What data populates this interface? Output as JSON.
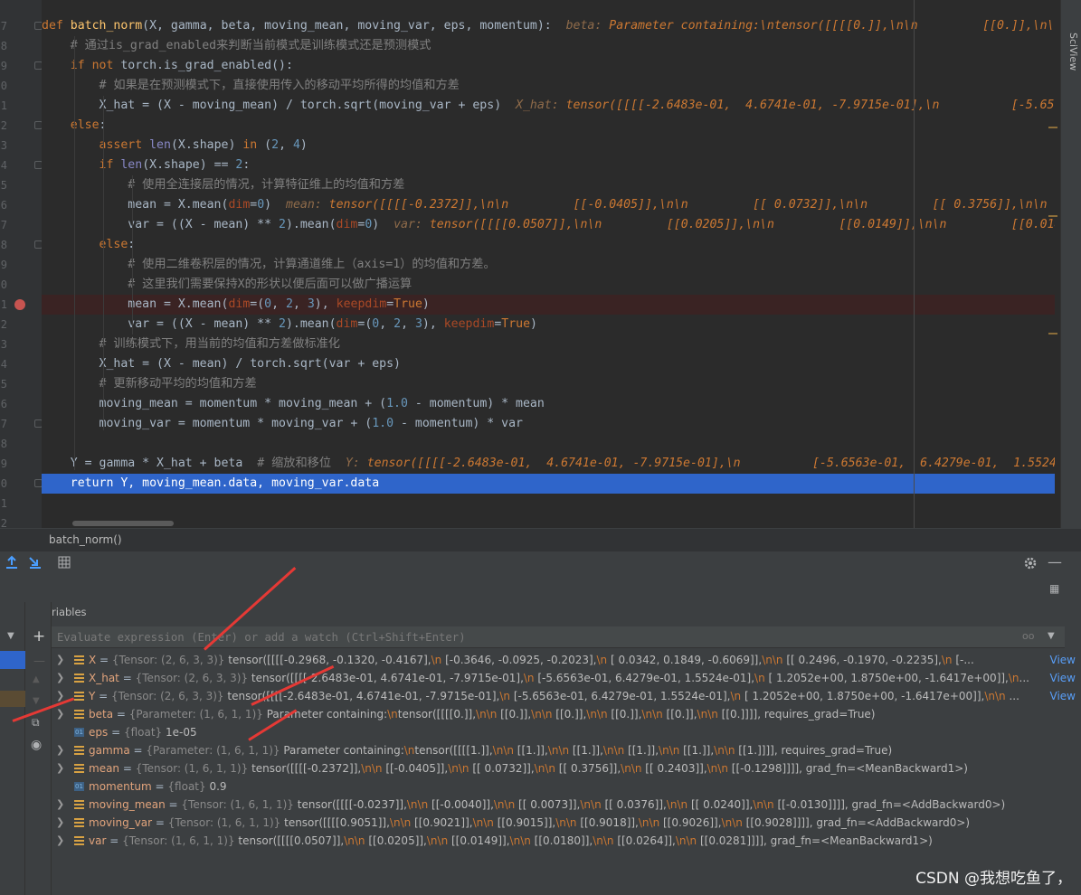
{
  "editor": {
    "line_numbers": [
      "7",
      "8",
      "9",
      "0",
      "1",
      "2",
      "3",
      "4",
      "5",
      "6",
      "7",
      "8",
      "9",
      "0",
      "1",
      "2",
      "3",
      "4",
      "5",
      "6",
      "7",
      "8",
      "9",
      "0",
      "1",
      "2",
      "3"
    ],
    "lines": [
      [
        [
          "kw",
          "def "
        ],
        [
          "fn",
          "batch_norm"
        ],
        [
          "",
          "(X, gamma, beta, moving_mean, moving_var, eps, momentum):"
        ],
        [
          "inlv",
          "  beta: "
        ],
        [
          "inl",
          "Parameter containing:\\ntensor([[[[0.]],\\n\\n         [[0.]],\\n\\n"
        ]
      ],
      [
        [
          "",
          "    "
        ],
        [
          "cm",
          "# 通过is_grad_enabled来判断当前模式是训练模式还是预测模式"
        ]
      ],
      [
        [
          "",
          "    "
        ],
        [
          "kw",
          "if not "
        ],
        [
          "",
          "torch.is_grad_enabled():"
        ]
      ],
      [
        [
          "",
          "        "
        ],
        [
          "cm",
          "# 如果是在预测模式下，直接使用传入的移动平均所得的均值和方差"
        ]
      ],
      [
        [
          "",
          "        X_hat = (X - moving_mean) / torch.sqrt(moving_var + eps)"
        ],
        [
          "inlv",
          "  X_hat: "
        ],
        [
          "inl",
          "tensor([[[[-2.6483e-01,  4.6741e-01, -7.9715e-01],\\n          [-5.6563e-01"
        ]
      ],
      [
        [
          "",
          "    "
        ],
        [
          "kw",
          "else"
        ],
        [
          "",
          ":"
        ]
      ],
      [
        [
          "",
          "        "
        ],
        [
          "kw",
          "assert "
        ],
        [
          "bi",
          "len"
        ],
        [
          "",
          "(X.shape) "
        ],
        [
          "kw",
          "in "
        ],
        [
          "",
          "("
        ],
        [
          "num",
          "2"
        ],
        [
          "",
          ", "
        ],
        [
          "num",
          "4"
        ],
        [
          "",
          ")"
        ]
      ],
      [
        [
          "",
          "        "
        ],
        [
          "kw",
          "if "
        ],
        [
          "bi",
          "len"
        ],
        [
          "",
          "(X.shape) == "
        ],
        [
          "num",
          "2"
        ],
        [
          "",
          ":"
        ]
      ],
      [
        [
          "",
          "            "
        ],
        [
          "cm",
          "# 使用全连接层的情况，计算特征维上的均值和方差"
        ]
      ],
      [
        [
          "",
          "            mean = X.mean("
        ],
        [
          "named",
          "dim"
        ],
        [
          "",
          "="
        ],
        [
          "num",
          "0"
        ],
        [
          "",
          ")"
        ],
        [
          "inlv",
          "  mean: "
        ],
        [
          "inl",
          "tensor([[[[-0.2372]],\\n\\n         [[-0.0405]],\\n\\n         [[ 0.0732]],\\n\\n         [[ 0.3756]],\\n\\n"
        ]
      ],
      [
        [
          "",
          "            var = ((X - mean) ** "
        ],
        [
          "num",
          "2"
        ],
        [
          "",
          ").mean("
        ],
        [
          "named",
          "dim"
        ],
        [
          "",
          "="
        ],
        [
          "num",
          "0"
        ],
        [
          "",
          ")"
        ],
        [
          "inlv",
          "  var: "
        ],
        [
          "inl",
          "tensor([[[[0.0507]],\\n\\n         [[0.0205]],\\n\\n         [[0.0149]],\\n\\n         [[0.0180]]"
        ]
      ],
      [
        [
          "",
          "        "
        ],
        [
          "kw",
          "else"
        ],
        [
          "",
          ":"
        ]
      ],
      [
        [
          "",
          "            "
        ],
        [
          "cm",
          "# 使用二维卷积层的情况，计算通道维上（axis=1）的均值和方差。"
        ]
      ],
      [
        [
          "",
          "            "
        ],
        [
          "cm",
          "# 这里我们需要保持X的形状以便后面可以做广播运算"
        ]
      ],
      [
        [
          "",
          "            mean = X.mean("
        ],
        [
          "named",
          "dim"
        ],
        [
          "",
          "=("
        ],
        [
          "num",
          "0"
        ],
        [
          "",
          ", "
        ],
        [
          "num",
          "2"
        ],
        [
          "",
          ", "
        ],
        [
          "num",
          "3"
        ],
        [
          "",
          "), "
        ],
        [
          "named",
          "keepdim"
        ],
        [
          "",
          "="
        ],
        [
          "kw",
          "True"
        ],
        [
          "",
          ")"
        ]
      ],
      [
        [
          "",
          "            var = ((X - mean) ** "
        ],
        [
          "num",
          "2"
        ],
        [
          "",
          ").mean("
        ],
        [
          "named",
          "dim"
        ],
        [
          "",
          "=("
        ],
        [
          "num",
          "0"
        ],
        [
          "",
          ", "
        ],
        [
          "num",
          "2"
        ],
        [
          "",
          ", "
        ],
        [
          "num",
          "3"
        ],
        [
          "",
          "), "
        ],
        [
          "named",
          "keepdim"
        ],
        [
          "",
          "="
        ],
        [
          "kw",
          "True"
        ],
        [
          "",
          ")"
        ]
      ],
      [
        [
          "",
          "        "
        ],
        [
          "cm",
          "# 训练模式下，用当前的均值和方差做标准化"
        ]
      ],
      [
        [
          "",
          "        X_hat = (X - mean) / torch.sqrt(var + eps)"
        ]
      ],
      [
        [
          "",
          "        "
        ],
        [
          "cm",
          "# 更新移动平均的均值和方差"
        ]
      ],
      [
        [
          "",
          "        moving_mean = momentum * moving_mean + ("
        ],
        [
          "num",
          "1.0"
        ],
        [
          "",
          " - momentum) * mean"
        ]
      ],
      [
        [
          "",
          "        moving_var = momentum * moving_var + ("
        ],
        [
          "num",
          "1.0"
        ],
        [
          "",
          " - momentum) * var"
        ]
      ],
      [
        [
          "",
          ""
        ]
      ],
      [
        [
          "",
          "    Y = gamma * X_hat + beta  "
        ],
        [
          "cm",
          "# 缩放和移位"
        ],
        [
          "inlv",
          "  Y: "
        ],
        [
          "inl",
          "tensor([[[[-2.6483e-01,  4.6741e-01, -7.9715e-01],\\n          [-5.6563e-01,  6.4279e-01,  1.5524e-01"
        ]
      ],
      [
        [
          "",
          "    return Y, moving_mean.data, moving_var.data"
        ]
      ],
      [
        [
          "",
          ""
        ]
      ],
      [
        [
          "",
          ""
        ]
      ]
    ],
    "scroll_label": "SciView"
  },
  "breadcrumb": "batch_norm()",
  "debugger": {
    "variables_title": "Variables",
    "eval_placeholder": "Evaluate expression (Enter) or add a watch (Ctrl+Shift+Enter)",
    "view_label": "View",
    "variables": [
      {
        "name": "X",
        "type": "{Tensor: (2, 6, 3, 3)}",
        "kind": "tensor",
        "value": "tensor([[[[-0.2968, -0.1320, -0.4167],\\n          [-0.3646, -0.0925, -0.2023],\\n          [ 0.0342,  0.1849, -0.6069]],\\n\\n         [[ 0.2496, -0.1970, -0.2235],\\n          [-...",
        "view": true
      },
      {
        "name": "X_hat",
        "type": "{Tensor: (2, 6, 3, 3)}",
        "kind": "tensor",
        "value": "tensor([[[[-2.6483e-01,  4.6741e-01, -7.9715e-01],\\n          [-5.6563e-01,  6.4279e-01,  1.5524e-01],\\n          [ 1.2052e+00,  1.8750e+00, -1.6417e+00]],\\n...",
        "view": true
      },
      {
        "name": "Y",
        "type": "{Tensor: (2, 6, 3, 3)}",
        "kind": "tensor",
        "value": "tensor([[[[-2.6483e-01,  4.6741e-01, -7.9715e-01],\\n          [-5.6563e-01,  6.4279e-01,  1.5524e-01],\\n          [ 1.2052e+00,  1.8750e+00, -1.6417e+00]],\\n\\n ...",
        "view": true
      },
      {
        "name": "beta",
        "type": "{Parameter: (1, 6, 1, 1)}",
        "kind": "tensor",
        "value": "Parameter containing:\\ntensor([[[[0.]],\\n\\n         [[0.]],\\n\\n         [[0.]],\\n\\n         [[0.]],\\n\\n         [[0.]],\\n\\n         [[0.]]]], requires_grad=True)",
        "view": false
      },
      {
        "name": "eps",
        "type": "{float}",
        "kind": "float",
        "value": "1e-05",
        "view": false
      },
      {
        "name": "gamma",
        "type": "{Parameter: (1, 6, 1, 1)}",
        "kind": "tensor",
        "value": "Parameter containing:\\ntensor([[[[1.]],\\n\\n         [[1.]],\\n\\n         [[1.]],\\n\\n         [[1.]],\\n\\n         [[1.]],\\n\\n         [[1.]]]], requires_grad=True)",
        "view": false
      },
      {
        "name": "mean",
        "type": "{Tensor: (1, 6, 1, 1)}",
        "kind": "tensor",
        "value": "tensor([[[[-0.2372]],\\n\\n         [[-0.0405]],\\n\\n         [[ 0.0732]],\\n\\n         [[ 0.3756]],\\n\\n         [[ 0.2403]],\\n\\n         [[-0.1298]]]], grad_fn=<MeanBackward1>)",
        "view": false
      },
      {
        "name": "momentum",
        "type": "{float}",
        "kind": "float",
        "value": "0.9",
        "view": false
      },
      {
        "name": "moving_mean",
        "type": "{Tensor: (1, 6, 1, 1)}",
        "kind": "tensor",
        "value": "tensor([[[[-0.0237]],\\n\\n         [[-0.0040]],\\n\\n         [[ 0.0073]],\\n\\n         [[ 0.0376]],\\n\\n         [[ 0.0240]],\\n\\n         [[-0.0130]]]], grad_fn=<AddBackward0>)",
        "view": false
      },
      {
        "name": "moving_var",
        "type": "{Tensor: (1, 6, 1, 1)}",
        "kind": "tensor",
        "value": "tensor([[[[0.9051]],\\n\\n         [[0.9021]],\\n\\n         [[0.9015]],\\n\\n         [[0.9018]],\\n\\n         [[0.9026]],\\n\\n         [[0.9028]]]], grad_fn=<AddBackward0>)",
        "view": false
      },
      {
        "name": "var",
        "type": "{Tensor: (1, 6, 1, 1)}",
        "kind": "tensor",
        "value": "tensor([[[[0.0507]],\\n\\n         [[0.0205]],\\n\\n         [[0.0149]],\\n\\n         [[0.0180]],\\n\\n         [[0.0264]],\\n\\n         [[0.0281]]]], grad_fn=<MeanBackward1>)",
        "view": false
      }
    ]
  },
  "watermark": "CSDN @我想吃鱼了，",
  "colors": {
    "accent": "#2f65ca",
    "breakpoint": "#c75450",
    "annotation_arrow": "#e53935"
  }
}
